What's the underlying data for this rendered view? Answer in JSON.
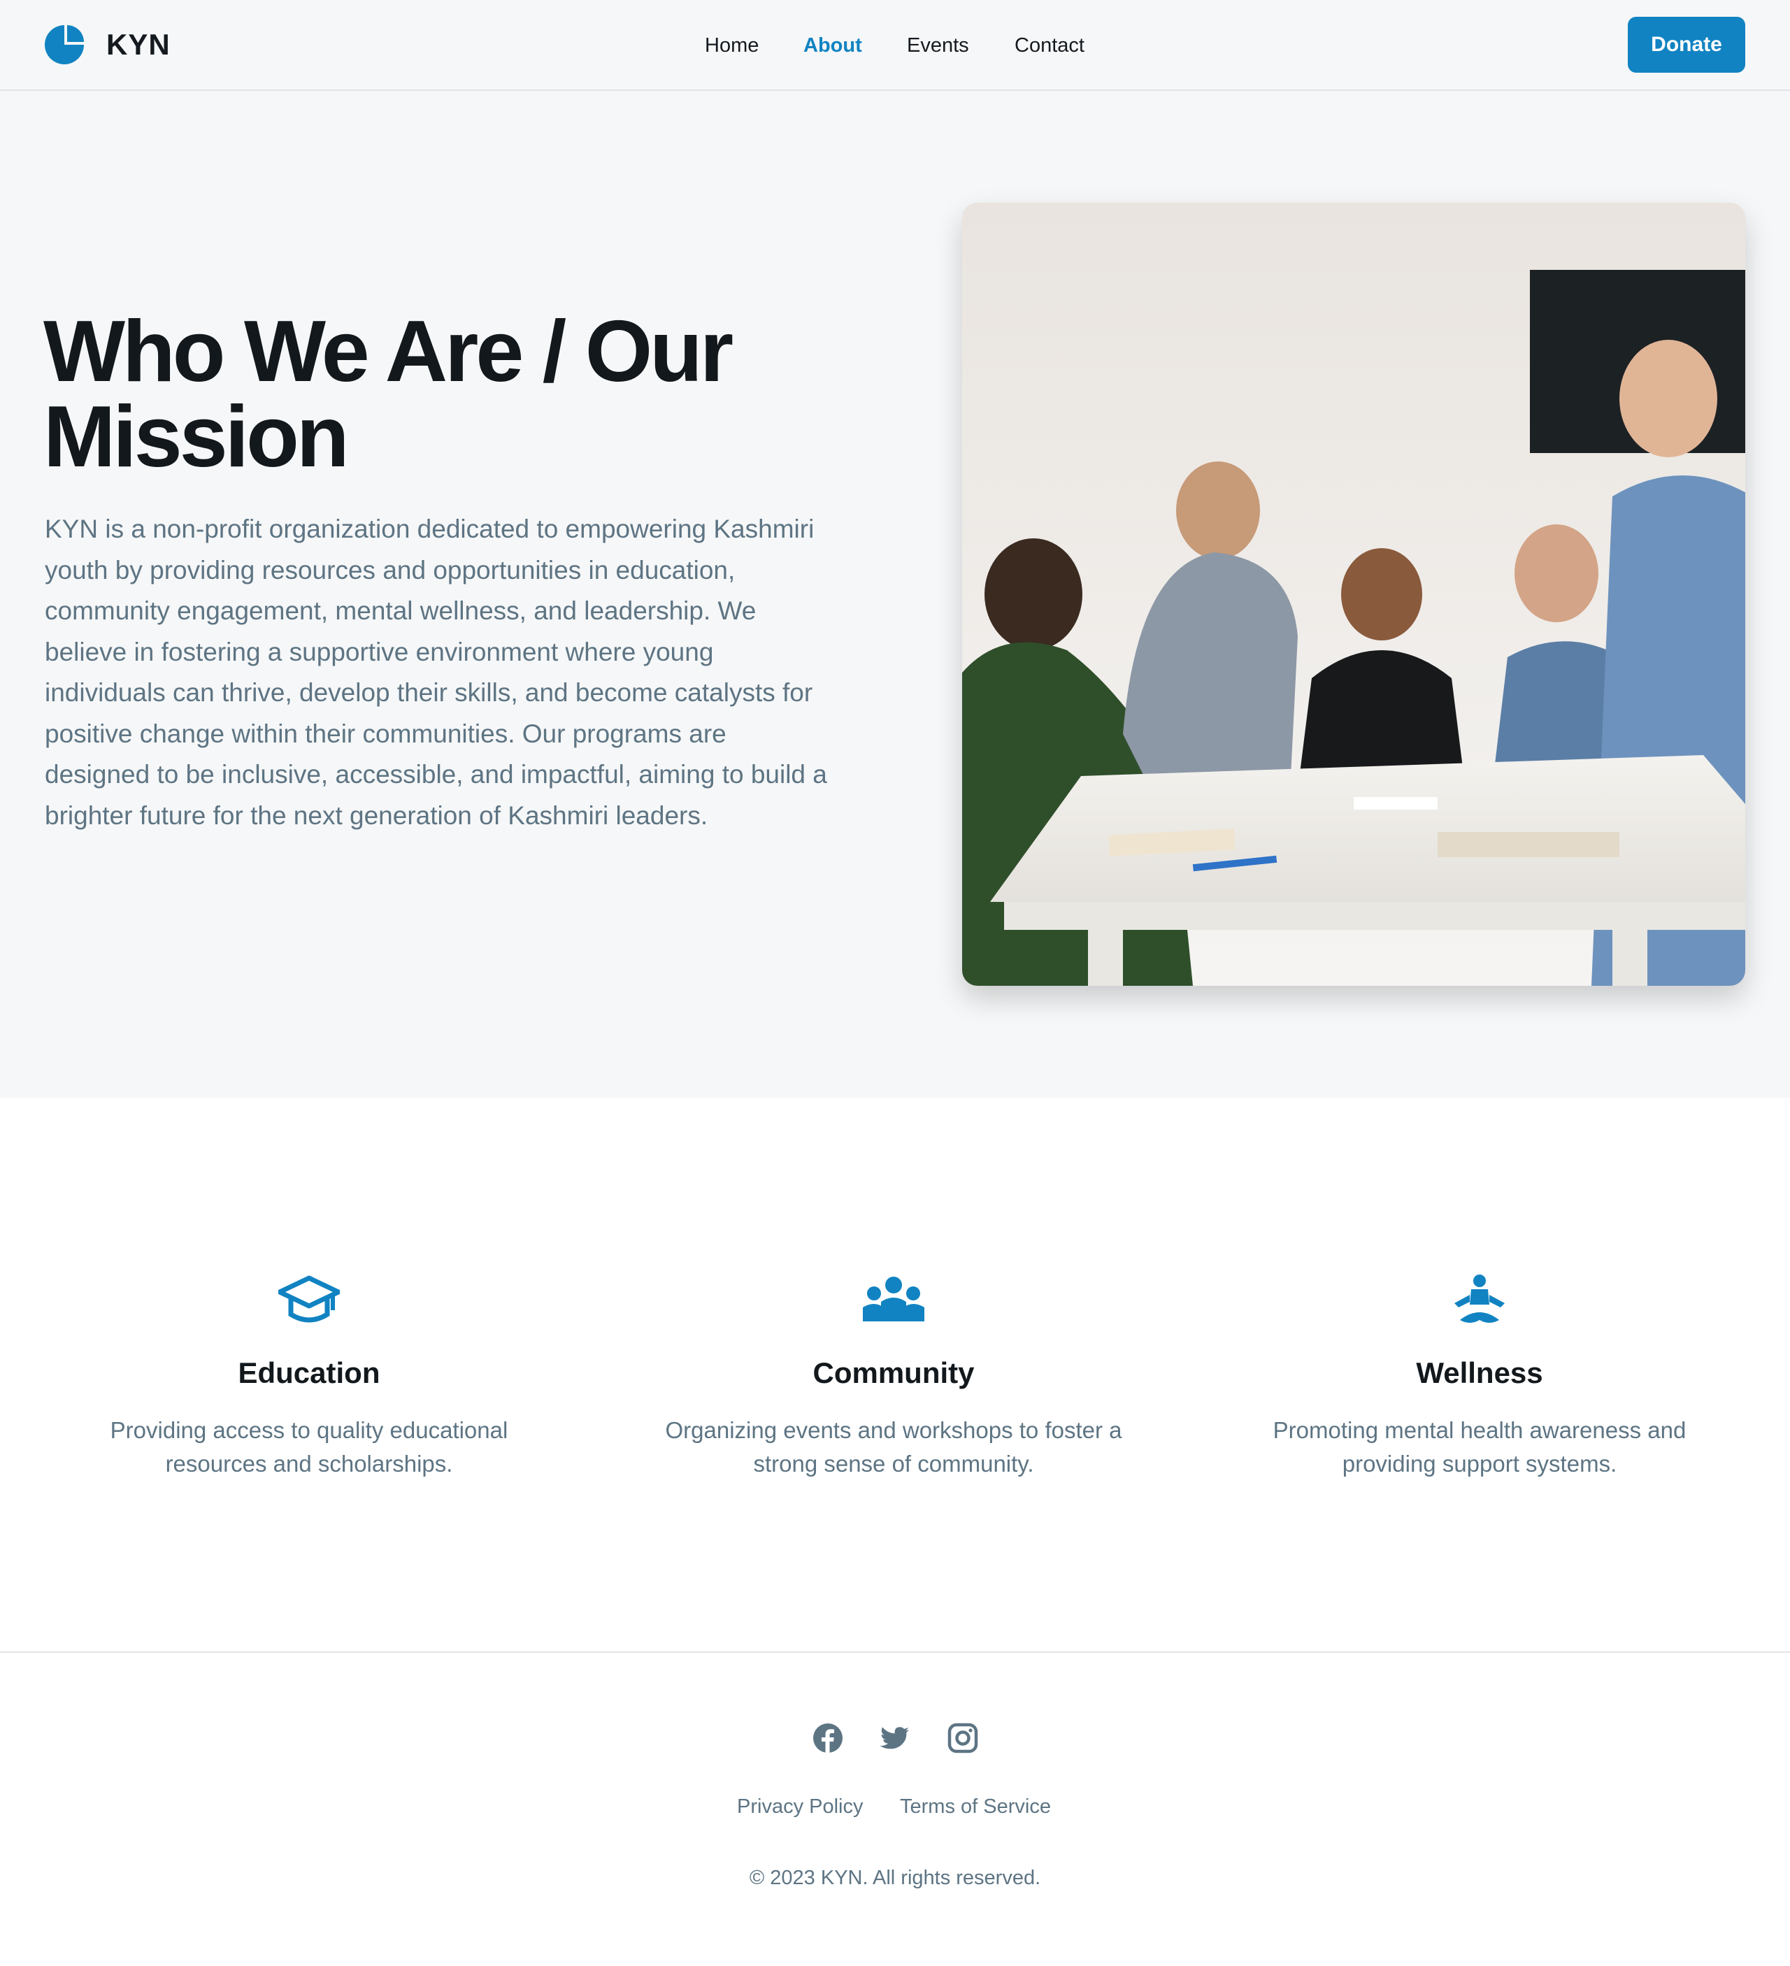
{
  "colors": {
    "accent": "#1183c2",
    "heading": "#12181c",
    "body_text": "#5d7483",
    "hero_bg": "#f6f7f8"
  },
  "header": {
    "brand": "KYN",
    "logo_icon": "kyn-logo-icon",
    "nav": [
      {
        "label": "Home",
        "active": false
      },
      {
        "label": "About",
        "active": true
      },
      {
        "label": "Events",
        "active": false
      },
      {
        "label": "Contact",
        "active": false
      }
    ],
    "donate_label": "Donate"
  },
  "hero": {
    "title": "Who We Are / Our Mission",
    "text": "KYN is a non-profit organization dedicated to empowering Kashmiri youth by providing resources and opportunities in education, community engagement, mental wellness, and leadership. We believe in fostering a supportive environment where young individuals can thrive, develop their skills, and become catalysts for positive change within their communities. Our programs are designed to be inclusive, accessible, and impactful, aiming to build a brighter future for the next generation of Kashmiri leaders.",
    "image_icon": "team-meeting-photo"
  },
  "features": [
    {
      "icon": "graduation-cap-icon",
      "title": "Education",
      "desc": "Providing access to quality educational resources and scholarships."
    },
    {
      "icon": "community-group-icon",
      "title": "Community",
      "desc": "Organizing events and workshops to foster a strong sense of community."
    },
    {
      "icon": "meditation-icon",
      "title": "Wellness",
      "desc": "Promoting mental health awareness and providing support systems."
    }
  ],
  "footer": {
    "social": [
      "facebook-icon",
      "twitter-icon",
      "instagram-icon"
    ],
    "links": [
      "Privacy Policy",
      "Terms of Service"
    ],
    "copyright": "© 2023 KYN. All rights reserved."
  }
}
